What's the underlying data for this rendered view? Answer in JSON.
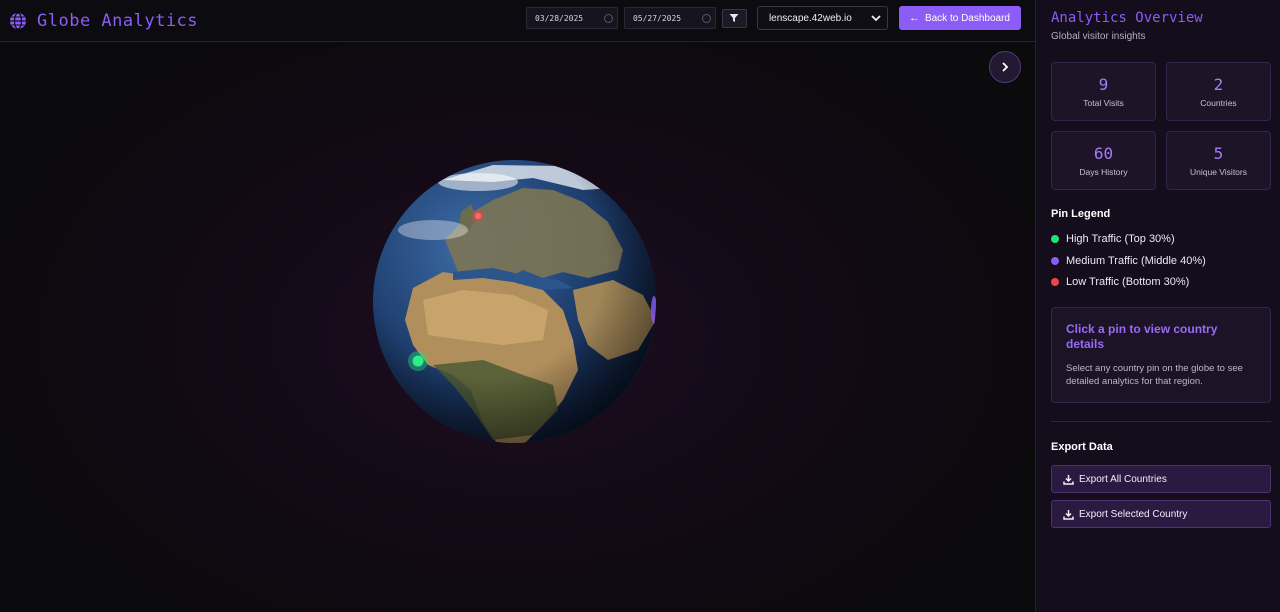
{
  "header": {
    "title": "Globe Analytics",
    "start_date": "03/28/2025",
    "end_date": "05/27/2025",
    "site": "lenscape.42web.io",
    "back_label": "Back to Dashboard"
  },
  "sidebar": {
    "title": "Analytics Overview",
    "subtitle": "Global visitor insights",
    "stats": [
      {
        "value": "9",
        "label": "Total Visits"
      },
      {
        "value": "2",
        "label": "Countries"
      },
      {
        "value": "60",
        "label": "Days History"
      },
      {
        "value": "5",
        "label": "Unique Visitors"
      }
    ],
    "legend": {
      "title": "Pin Legend",
      "items": [
        {
          "label": "High Traffic (Top 30%)",
          "color": "#22e07a"
        },
        {
          "label": "Medium Traffic (Middle 40%)",
          "color": "#8b5cf6"
        },
        {
          "label": "Low Traffic (Bottom 30%)",
          "color": "#ef4444"
        }
      ]
    },
    "info": {
      "heading": "Click a pin to view country details",
      "body": "Select any country pin on the globe to see detailed analytics for that region."
    },
    "export": {
      "title": "Export Data",
      "all_label": "Export All Countries",
      "selected_label": "Export Selected Country"
    }
  },
  "colors": {
    "accent": "#8b5cf6",
    "high": "#22e07a",
    "medium": "#8b5cf6",
    "low": "#ef4444"
  },
  "icons": {
    "brand": "globe-icon",
    "calendar": "calendar-icon",
    "filter": "filter-icon",
    "select": "chevron-down-icon",
    "back": "arrow-left-icon",
    "expand": "chevron-right-icon",
    "export": "download-icon"
  }
}
